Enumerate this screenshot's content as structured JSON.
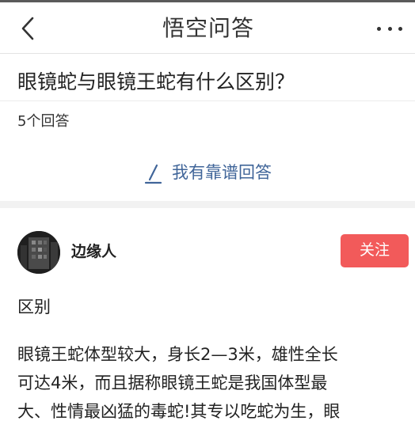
{
  "header": {
    "logo_text_1": "悟空",
    "logo_text_2": "问",
    "logo_text_3": "答"
  },
  "question": {
    "title": "眼镜蛇与眼镜王蛇有什么区别？",
    "answer_count": "5个回答",
    "write_answer_label": "我有靠谱回答"
  },
  "answer": {
    "author_name": "边缘人",
    "follow_label": "关注",
    "heading": "区别",
    "paragraph": "眼镜王蛇体型较大，身长2—3米，雄性全长\n可达4米，而且据称眼镜王蛇是我国体型最\n大、性情最凶猛的毒蛇!其专以吃蛇为生，眼"
  },
  "colors": {
    "follow_button": "#f25a5a",
    "write_answer_text": "#406599",
    "logo_accent": "#f4a63a"
  },
  "icons": {
    "back": "chevron-left-icon",
    "more": "more-dots-icon",
    "write": "pen-icon"
  }
}
